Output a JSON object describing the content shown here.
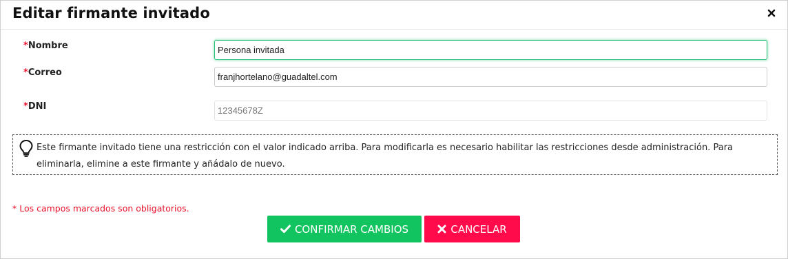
{
  "dialog": {
    "title": "Editar firmante invitado",
    "close_icon": "close-icon"
  },
  "form": {
    "required_marker": "*",
    "nombre": {
      "label": "Nombre",
      "value": "Persona invitada",
      "focused": true
    },
    "correo": {
      "label": "Correo",
      "value": "franjhortelano@guadaltel.com"
    },
    "dni": {
      "label": "DNI",
      "placeholder": "12345678Z",
      "readonly": true
    }
  },
  "notice": {
    "icon": "lightbulb-icon",
    "text": "Este firmante invitado tiene una restricción con el valor indicado arriba. Para modificarla es necesario habilitar las restricciones desde administración. Para eliminarla, elimine a este firmante y añádalo de nuevo."
  },
  "required_note": "* Los campos marcados son obligatorios.",
  "buttons": {
    "confirm": {
      "label": "CONFIRMAR CAMBIOS",
      "icon": "check-icon"
    },
    "cancel": {
      "label": "CANCELAR",
      "icon": "x-icon"
    }
  },
  "colors": {
    "confirm": "#12c45f",
    "cancel": "#ff0a4a",
    "required": "#e8102b",
    "focus_border": "#2bbf7a"
  }
}
